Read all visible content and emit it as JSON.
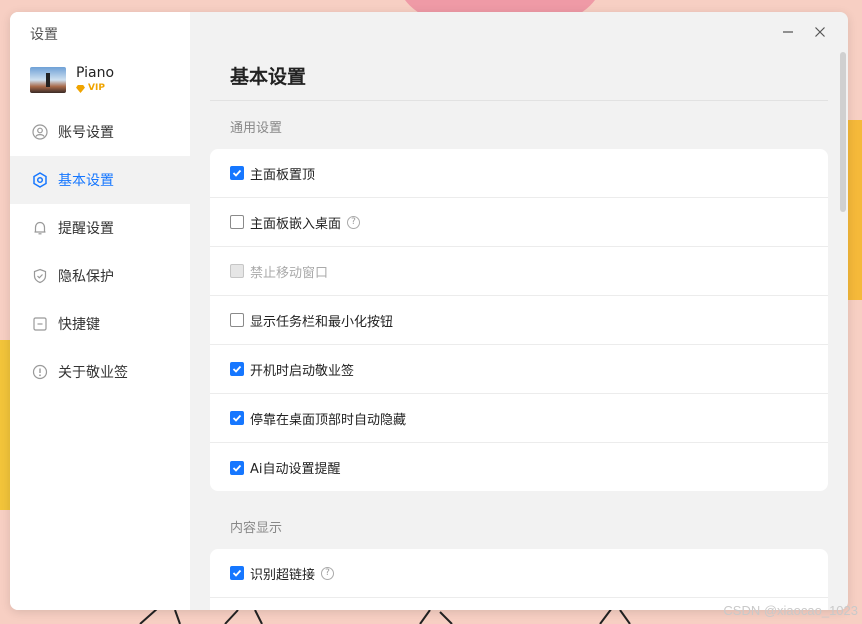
{
  "window": {
    "title": "设置"
  },
  "profile": {
    "name": "Piano",
    "badge": "VIP"
  },
  "sidebar": {
    "items": [
      {
        "label": "账号设置",
        "icon": "user-icon",
        "active": false
      },
      {
        "label": "基本设置",
        "icon": "settings-hex-icon",
        "active": true
      },
      {
        "label": "提醒设置",
        "icon": "bell-icon",
        "active": false
      },
      {
        "label": "隐私保护",
        "icon": "shield-icon",
        "active": false
      },
      {
        "label": "快捷键",
        "icon": "keyboard-icon",
        "active": false
      },
      {
        "label": "关于敬业签",
        "icon": "info-icon",
        "active": false
      }
    ]
  },
  "main": {
    "title": "基本设置",
    "sections": [
      {
        "title": "通用设置",
        "options": [
          {
            "label": "主面板置顶",
            "checked": true,
            "disabled": false,
            "help": false
          },
          {
            "label": "主面板嵌入桌面",
            "checked": false,
            "disabled": false,
            "help": true
          },
          {
            "label": "禁止移动窗口",
            "checked": false,
            "disabled": true,
            "help": false
          },
          {
            "label": "显示任务栏和最小化按钮",
            "checked": false,
            "disabled": false,
            "help": false
          },
          {
            "label": "开机时启动敬业签",
            "checked": true,
            "disabled": false,
            "help": false
          },
          {
            "label": "停靠在桌面顶部时自动隐藏",
            "checked": true,
            "disabled": false,
            "help": false
          },
          {
            "label": "Ai自动设置提醒",
            "checked": true,
            "disabled": false,
            "help": false
          }
        ]
      },
      {
        "title": "内容显示",
        "options": [
          {
            "label": "识别超链接",
            "checked": true,
            "disabled": false,
            "help": true
          }
        ]
      }
    ]
  },
  "colors": {
    "accent": "#1677ff",
    "vip": "#f0a400",
    "window_bg": "#f2f2f2",
    "page_bg": "#f7cfc3"
  },
  "watermark": "CSDN @xiaocao_1023"
}
